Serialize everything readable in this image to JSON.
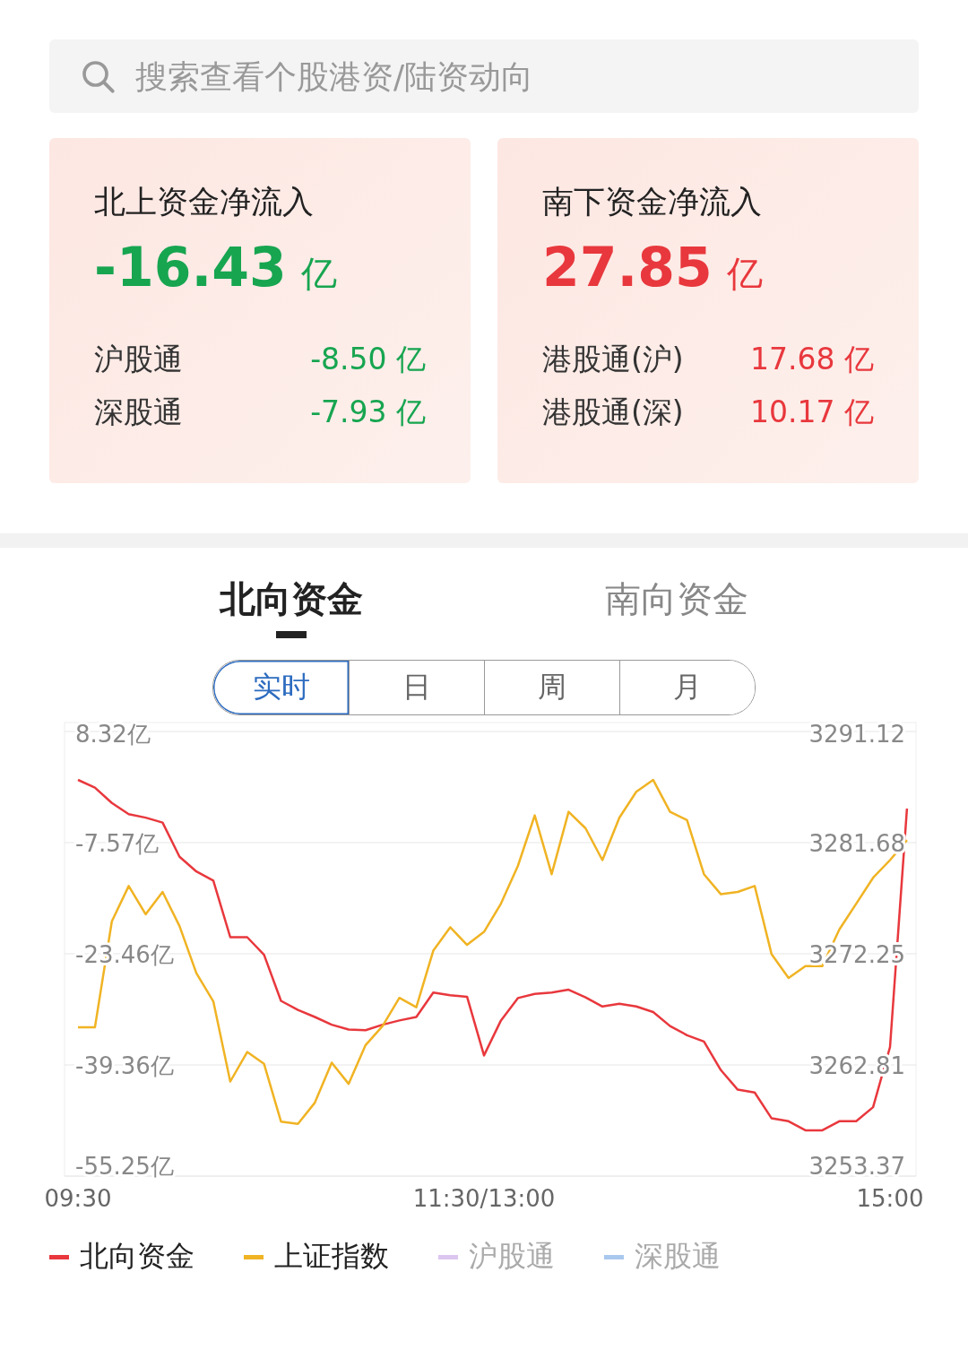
{
  "search": {
    "placeholder": "搜索查看个股港资/陆资动向"
  },
  "summary_cards": [
    {
      "title": "北上资金净流入",
      "amount": "-16.43",
      "unit": "亿",
      "color": "#17a550",
      "rows": [
        {
          "label": "沪股通",
          "value": "-8.50 亿"
        },
        {
          "label": "深股通",
          "value": "-7.93 亿"
        }
      ]
    },
    {
      "title": "南下资金净流入",
      "amount": "27.85",
      "unit": "亿",
      "color": "#e8383d",
      "rows": [
        {
          "label": "港股通(沪)",
          "value": "17.68 亿"
        },
        {
          "label": "港股通(深)",
          "value": "10.17 亿"
        }
      ]
    }
  ],
  "tabs": [
    {
      "label": "北向资金",
      "selected": true
    },
    {
      "label": "南向资金",
      "selected": false
    }
  ],
  "periods": [
    {
      "label": "实时",
      "selected": true
    },
    {
      "label": "日",
      "selected": false
    },
    {
      "label": "周",
      "selected": false
    },
    {
      "label": "月",
      "selected": false
    }
  ],
  "chart_data": {
    "type": "line",
    "categories": [
      "09:30",
      null,
      null,
      null,
      null,
      null,
      null,
      null,
      null,
      null,
      null,
      null,
      null,
      null,
      null,
      null,
      null,
      null,
      null,
      null,
      null,
      null,
      null,
      null,
      "11:30/13:00",
      null,
      null,
      null,
      null,
      null,
      null,
      null,
      null,
      null,
      null,
      null,
      null,
      null,
      null,
      null,
      null,
      null,
      null,
      null,
      null,
      null,
      null,
      null,
      "15:00",
      null
    ],
    "grid": true,
    "ylim": [
      -55.25,
      8.32
    ],
    "yticks": [
      {
        "value": 8.32,
        "label": "8.32亿"
      },
      {
        "value": -7.57,
        "label": "-7.57亿"
      },
      {
        "value": -23.46,
        "label": "-23.46亿"
      },
      {
        "value": -39.36,
        "label": "-39.36亿"
      },
      {
        "value": -55.25,
        "label": "-55.25亿"
      }
    ],
    "y2lim": [
      3253.37,
      3291.12
    ],
    "y2ticks": [
      {
        "value": 3291.12,
        "label": "3291.12"
      },
      {
        "value": 3281.68,
        "label": "3281.68"
      },
      {
        "value": 3272.25,
        "label": "3272.25"
      },
      {
        "value": 3262.81,
        "label": "3262.81"
      },
      {
        "value": 3253.37,
        "label": "3253.37"
      }
    ],
    "series": [
      {
        "color": "#e8383d",
        "values": [
          1.4,
          0.3,
          -1.9,
          -3.5,
          -4.0,
          -4.7,
          -9.6,
          -11.7,
          -13.0,
          -21.1,
          -21.1,
          -23.6,
          -30.2,
          -31.5,
          -32.5,
          -33.6,
          -34.3,
          -34.4,
          -33.6,
          -33.0,
          -32.5,
          -29.0,
          -29.4,
          -29.6,
          -38.0,
          -33.0,
          -29.8,
          -29.2,
          -29.0,
          -28.6,
          -29.7,
          -31.0,
          -30.6,
          -31.0,
          -31.8,
          -33.8,
          -35.1,
          -36.0,
          -40.1,
          -42.9,
          -43.3,
          -47.0,
          -47.4,
          -48.7,
          -48.7,
          -47.4,
          -47.4,
          -45.4,
          -36.8,
          -2.7
        ]
      },
      {
        "color": "#f0b323",
        "axis": "y2",
        "values": [
          3266.0,
          3266.0,
          3275.0,
          3278.0,
          3275.6,
          3277.5,
          3274.6,
          3270.6,
          3268.2,
          3261.4,
          3263.9,
          3262.9,
          3258.0,
          3257.8,
          3259.6,
          3263.0,
          3261.2,
          3264.5,
          3266.1,
          3268.5,
          3267.7,
          3272.5,
          3274.5,
          3273.0,
          3274.1,
          3276.5,
          3279.7,
          3284.0,
          3279.0,
          3284.3,
          3282.9,
          3280.2,
          3283.8,
          3286.0,
          3287.0,
          3284.3,
          3283.6,
          3279.0,
          3277.3,
          3277.5,
          3278.0,
          3272.2,
          3270.2,
          3271.2,
          3271.2,
          3274.3,
          3276.5,
          3278.7,
          3280.2,
          3281.9
        ]
      }
    ]
  },
  "legend": [
    {
      "label": "北向资金",
      "color": "#e8383d",
      "selected": true
    },
    {
      "label": "上证指数",
      "color": "#f0b323",
      "selected": true
    },
    {
      "label": "沪股通",
      "color": "#dcc6f0",
      "selected": false
    },
    {
      "label": "深股通",
      "color": "#a9c8ee",
      "selected": false
    }
  ]
}
